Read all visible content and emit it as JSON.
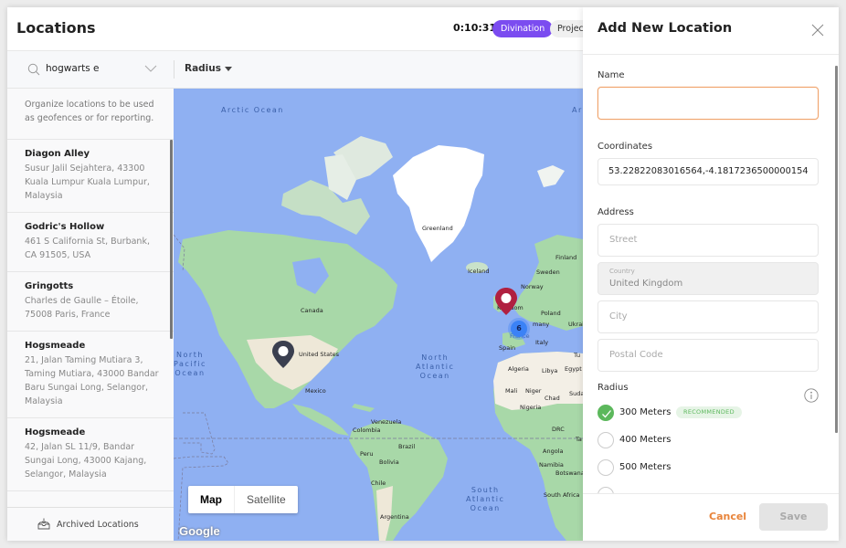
{
  "header": {
    "title": "Locations",
    "timer": "0:10:31",
    "badges": [
      "Divination",
      "Projec"
    ]
  },
  "toolbar": {
    "search_value": "hogwarts e",
    "radius_label": "Radius"
  },
  "sidebar": {
    "description": "Organize locations to be used as geofences or for reporting.",
    "items": [
      {
        "name": "Diagon Alley",
        "address": "Susur Jalil Sejahtera, 43300 Kuala Lumpur Kuala Lumpur, Malaysia"
      },
      {
        "name": "Godric's Hollow",
        "address": "461 S California St, Burbank, CA 91505, USA"
      },
      {
        "name": "Gringotts",
        "address": "Charles de Gaulle – Étoile, 75008 Paris, France"
      },
      {
        "name": "Hogsmeade",
        "address": "21, Jalan Taming Mutiara 3, Taming Mutiara, 43000 Bandar Baru Sungai Long, Selangor, Malaysia"
      },
      {
        "name": "Hogsmeade",
        "address": "42, Jalan SL 11/9, Bandar Sungai Long, 43000 Kajang, Selangor, Malaysia"
      }
    ],
    "archived_label": "Archived Locations"
  },
  "map": {
    "oceans": {
      "arctic": "Arctic Ocean",
      "arctic_right": "Ar",
      "north_pacific": "North\nPacific\nOcean",
      "north_atlantic": "North\nAtlantic\nOcean",
      "south_atlantic": "South\nAtlantic\nOcean"
    },
    "countries": {
      "greenland": "Greenland",
      "iceland": "Iceland",
      "finland": "Finland",
      "sweden": "Sweden",
      "norway": "Norway",
      "uk": "Kingdom",
      "poland": "Poland",
      "germany": "many",
      "ukraine": "Ukrai",
      "france": "France",
      "italy": "Italy",
      "spain": "Spain",
      "turkey": "Tu",
      "canada": "Canada",
      "us": "United States",
      "mexico": "Mexico",
      "venezuela": "Venezuela",
      "colombia": "Colombia",
      "peru": "Peru",
      "brazil": "Brazil",
      "bolivia": "Bolivia",
      "chile": "Chile",
      "argentina": "Argentina",
      "algeria": "Algeria",
      "libya": "Libya",
      "egypt": "Egypt",
      "mali": "Mali",
      "niger": "Niger",
      "chad": "Chad",
      "sudan": "Sudar",
      "nigeria": "Nigeria",
      "drc": "DRC",
      "tanzania": "Ta",
      "angola": "Angola",
      "namibia": "Namibia",
      "botswana": "Botswana",
      "south_africa": "South Africa"
    },
    "cluster_count": "6",
    "map_type": {
      "map": "Map",
      "satellite": "Satellite",
      "selected": "Map"
    },
    "attribution": "Google",
    "colors": {
      "water": "#8fb0f2",
      "land": "#a8d8a8",
      "pin_red": "#b02040",
      "pin_dark": "#3a3f4f",
      "cluster": "#3b82f6"
    }
  },
  "drawer": {
    "title": "Add New Location",
    "name_label": "Name",
    "name_value": "",
    "coordinates_label": "Coordinates",
    "coordinates_value": "53.22822083016564,-4.1817236500000154",
    "address_label": "Address",
    "street_placeholder": "Street",
    "country_label": "Country",
    "country_value": "United Kingdom",
    "city_placeholder": "City",
    "postal_placeholder": "Postal Code",
    "radius_label": "Radius",
    "radius_options": [
      {
        "label": "300 Meters",
        "checked": true,
        "badge": "RECOMMENDED"
      },
      {
        "label": "400 Meters",
        "checked": false
      },
      {
        "label": "500 Meters",
        "checked": false
      }
    ],
    "cancel_label": "Cancel",
    "save_label": "Save",
    "accent_color": "#e8843a"
  }
}
